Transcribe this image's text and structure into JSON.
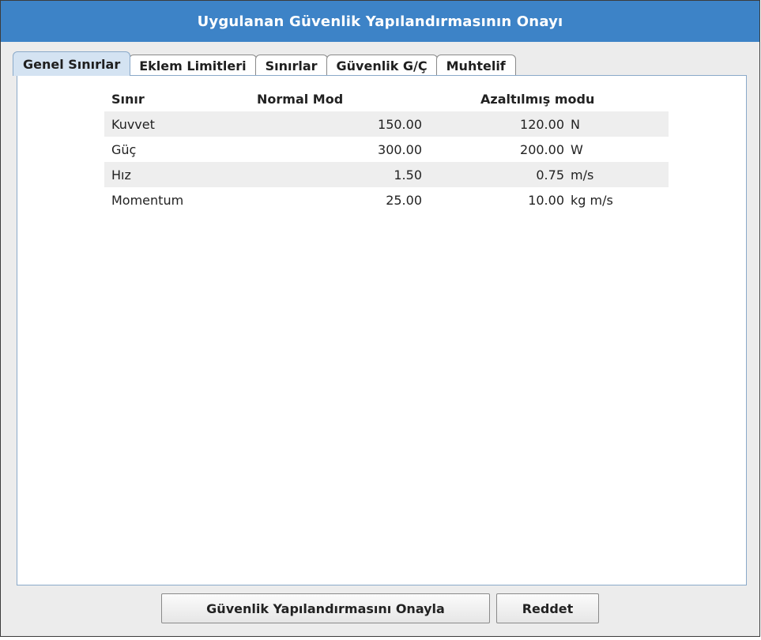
{
  "window": {
    "title": "Uygulanan Güvenlik Yapılandırmasının Onayı"
  },
  "tabs": [
    {
      "label": "Genel Sınırlar",
      "active": true
    },
    {
      "label": "Eklem Limitleri",
      "active": false
    },
    {
      "label": "Sınırlar",
      "active": false
    },
    {
      "label": "Güvenlik G/Ç",
      "active": false
    },
    {
      "label": "Muhtelif",
      "active": false
    }
  ],
  "table": {
    "headers": {
      "limit": "Sınır",
      "normal": "Normal Mod",
      "reduced": "Azaltılmış modu"
    },
    "rows": [
      {
        "limit": "Kuvvet",
        "normal": "150.00",
        "reduced": "120.00",
        "unit": "N"
      },
      {
        "limit": "Güç",
        "normal": "300.00",
        "reduced": "200.00",
        "unit": "W"
      },
      {
        "limit": "Hız",
        "normal": "1.50",
        "reduced": "0.75",
        "unit": "m/s"
      },
      {
        "limit": "Momentum",
        "normal": "25.00",
        "reduced": "10.00",
        "unit": "kg m/s"
      }
    ]
  },
  "buttons": {
    "confirm_label": "Güvenlik Yapılandırmasını Onayla",
    "reject_label": "Reddet"
  },
  "colors": {
    "titlebar": "#3d83c7",
    "active_tab": "#d4e3f2",
    "row_shade": "#eeeeee"
  }
}
